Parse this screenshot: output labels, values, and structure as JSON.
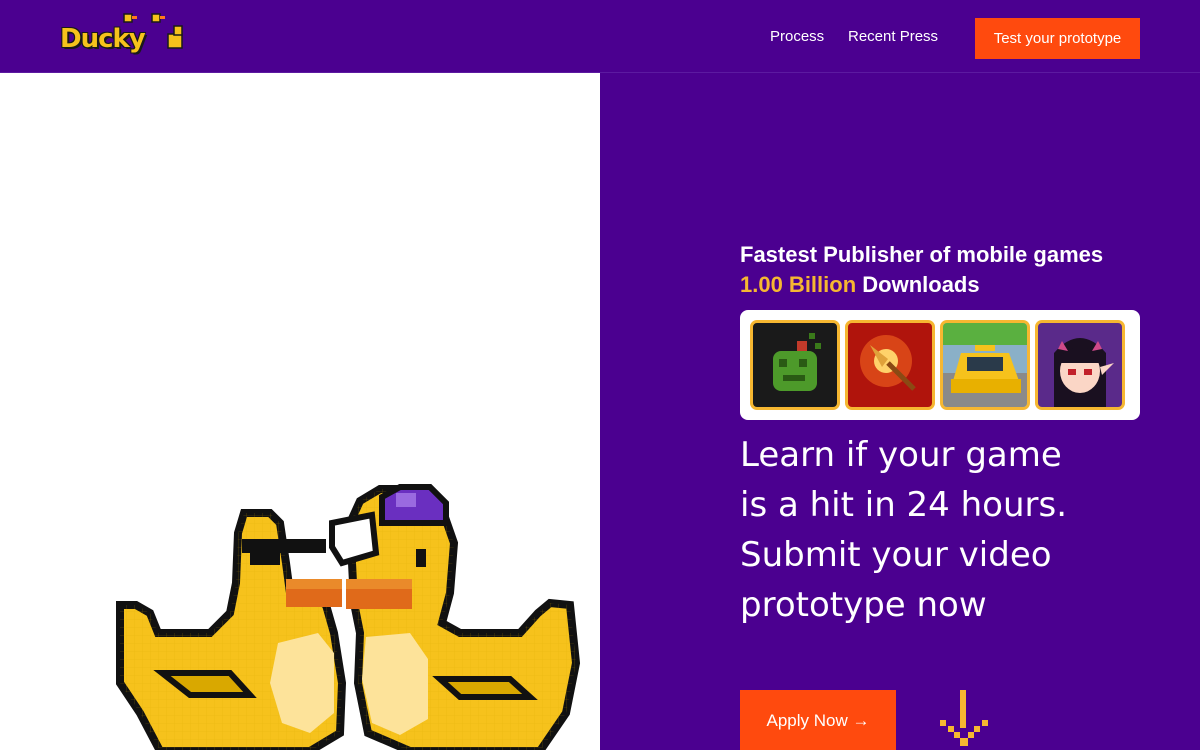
{
  "header": {
    "logo_text": "Ducky",
    "nav": [
      {
        "label": "Process"
      },
      {
        "label": "Recent Press"
      }
    ],
    "cta_label": "Test your prototype"
  },
  "hero": {
    "headline_line1": "Fastest Publisher of mobile games",
    "downloads_value": "1.00 Billion",
    "downloads_suffix": " Downloads",
    "games": [
      {
        "icon": "melon-zombie-game-icon"
      },
      {
        "icon": "magic-broom-game-icon"
      },
      {
        "icon": "yellow-taxi-game-icon"
      },
      {
        "icon": "demon-girl-game-icon"
      }
    ],
    "tagline": [
      "Learn if your game",
      "is a hit in 24 hours.",
      "Submit your video",
      "prototype now"
    ],
    "apply_label": "Apply Now →"
  },
  "colors": {
    "brand_purple": "#4b0090",
    "cta_orange": "#ff4a0e",
    "accent_yellow": "#f6b731"
  }
}
